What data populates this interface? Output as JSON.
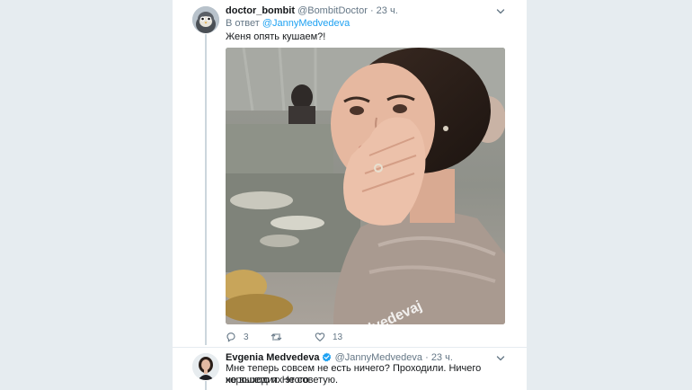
{
  "tweet1": {
    "name": "doctor_bombit",
    "handle": "@BombitDoctor",
    "separator": "·",
    "time": "23 ч.",
    "reply_prefix": "В ответ",
    "reply_mention": "@JannyMedvedeva",
    "text": "Женя опять кушаем?!",
    "media_watermark": "medvedevaj",
    "actions": {
      "reply_icon": "reply-icon",
      "reply_count": "3",
      "retweet_icon": "retweet-icon",
      "retweet_count": "",
      "like_icon": "heart-icon",
      "like_count": "13"
    }
  },
  "tweet2": {
    "name": "Evgenia Medvedeva",
    "verified_icon": "verified-badge-icon",
    "handle": "@JannyMedvedeva",
    "separator": "·",
    "time": "23 ч.",
    "text_line1": "Мне теперь совсем не есть ничего? Проходили. Ничего хорошего их этого",
    "text_line2": "не выходит. Не советую."
  },
  "colors": {
    "page_bg": "#e6ecf0",
    "card_bg": "#ffffff",
    "link": "#1da1f2",
    "muted": "#657786",
    "thread_line": "#ccd6dd",
    "verified": "#1da1f2"
  }
}
